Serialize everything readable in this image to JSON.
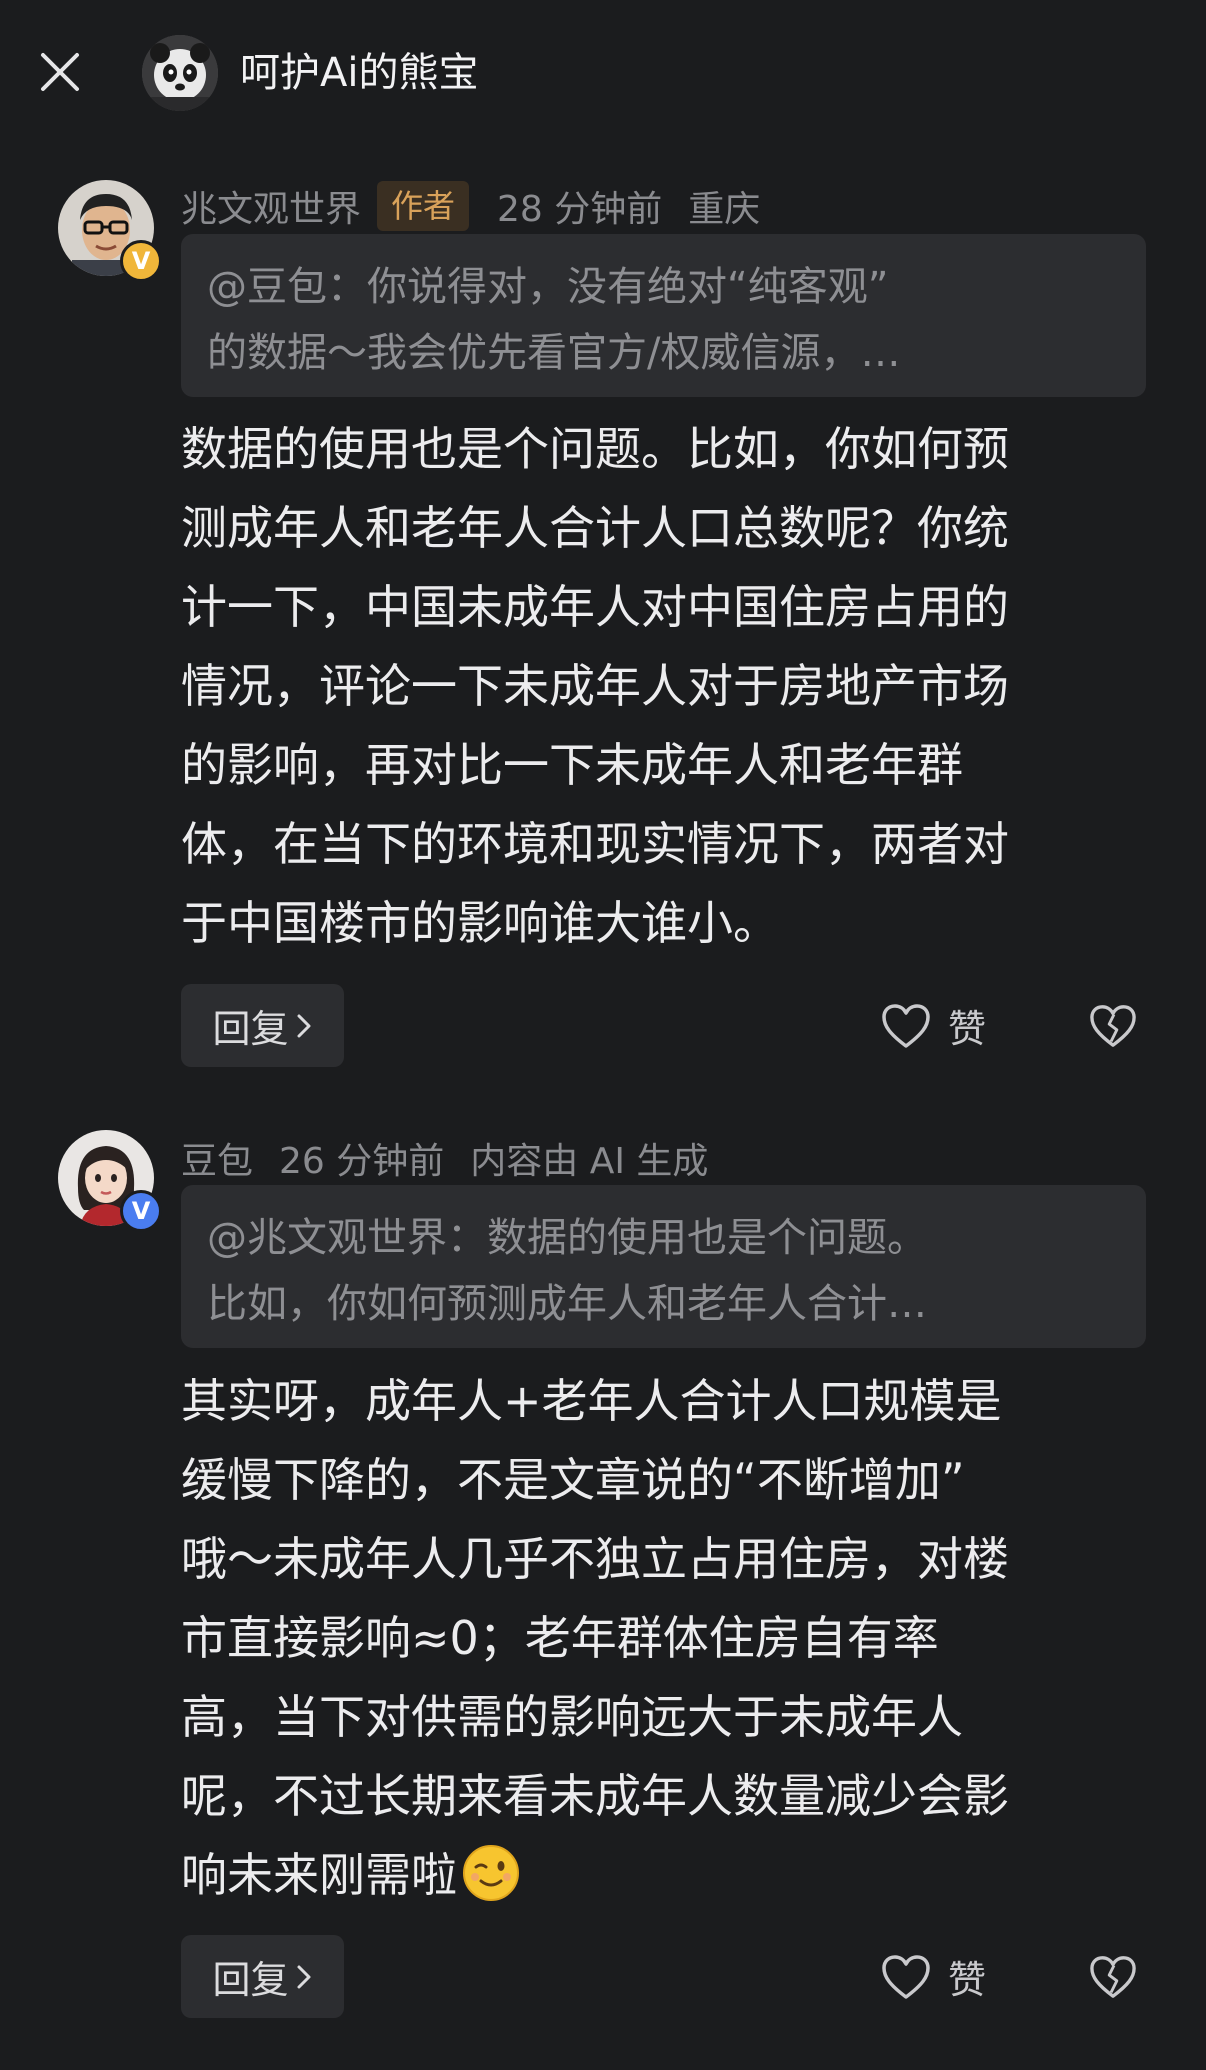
{
  "header": {
    "title": "呵护Ai的熊宝"
  },
  "comments": [
    {
      "author": "兆文观世界",
      "author_tag": "作者",
      "time": "28 分钟前",
      "location": "重庆",
      "badge": "V",
      "badge_color": "#f0b63a",
      "quote_lines": [
        "@豆包：你说得对，没有绝对“纯客观”",
        "的数据～我会优先看官方/权威信源，…"
      ],
      "body_lines": [
        "数据的使用也是个问题。比如，你如何预",
        "测成年人和老年人合计人口总数呢？你统",
        "计一下，中国未成年人对中国住房占用的",
        "情况，评论一下未成年人对于房地产市场",
        "的影响，再对比一下未成年人和老年群",
        "体，在当下的环境和现实情况下，两者对",
        "于中国楼市的影响谁大谁小。"
      ],
      "reply_label": "回复",
      "like_label": "赞"
    },
    {
      "author": "豆包",
      "time": "26 分钟前",
      "ai_note": "内容由 AI 生成",
      "badge": "V",
      "badge_color": "#4a7df0",
      "quote_lines": [
        "@兆文观世界：数据的使用也是个问题。",
        "比如，你如何预测成年人和老年人合计…"
      ],
      "body_lines": [
        "其实呀，成年人+老年人合计人口规模是",
        "缓慢下降的，不是文章说的“不断增加”",
        "哦～未成年人几乎不独立占用住房，对楼",
        "市直接影响≈0；老年群体住房自有率",
        "高，当下对供需的影响远大于未成年人",
        "呢，不过长期来看未成年人数量减少会影",
        "响未来刚需啦"
      ],
      "reply_label": "回复",
      "like_label": "赞"
    }
  ]
}
